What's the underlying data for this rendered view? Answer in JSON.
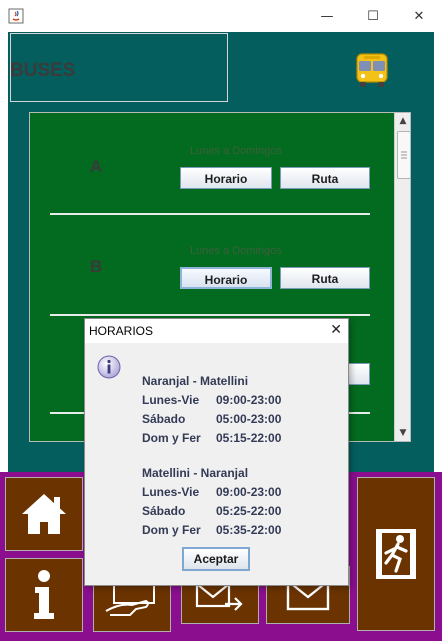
{
  "window": {
    "minimize_glyph": "—",
    "maximize_glyph": "☐",
    "close_glyph": "✕"
  },
  "header": {
    "title": "BUSES"
  },
  "routes": [
    {
      "letter": "A",
      "days": "Lunes a Domingos",
      "schedule_label": "Horario",
      "route_label": "Ruta"
    },
    {
      "letter": "B",
      "days": "Lunes a Domingos",
      "schedule_label": "Horario",
      "route_label": "Ruta"
    }
  ],
  "dialog": {
    "title": "HORARIOS",
    "close_glyph": "✕",
    "groups": [
      {
        "heading": "Naranjal - Matellini",
        "rows": [
          {
            "day": "Lunes-Vie",
            "time": "09:00-23:00"
          },
          {
            "day": "Sábado",
            "time": "05:00-23:00"
          },
          {
            "day": "Dom y Fer",
            "time": "05:15-22:00"
          }
        ]
      },
      {
        "heading": "Matellini - Naranjal",
        "rows": [
          {
            "day": "Lunes-Vie",
            "time": "09:00-23:00"
          },
          {
            "day": "Sábado",
            "time": "05:25-22:00"
          },
          {
            "day": "Dom y Fer",
            "time": "05:35-22:00"
          }
        ]
      }
    ],
    "ok_label": "Aceptar"
  },
  "colors": {
    "main_bg": "#045e5e",
    "panel_bg": "#036b1f",
    "bottom_bg": "#8a0e8e",
    "tile_bg": "#6b3300"
  },
  "icons": {
    "bus": "bus-icon",
    "home": "home-icon",
    "info": "info-icon",
    "touch": "hand-touch-icon",
    "send_mail": "send-mail-icon",
    "mail": "mail-icon",
    "exit": "exit-icon"
  }
}
